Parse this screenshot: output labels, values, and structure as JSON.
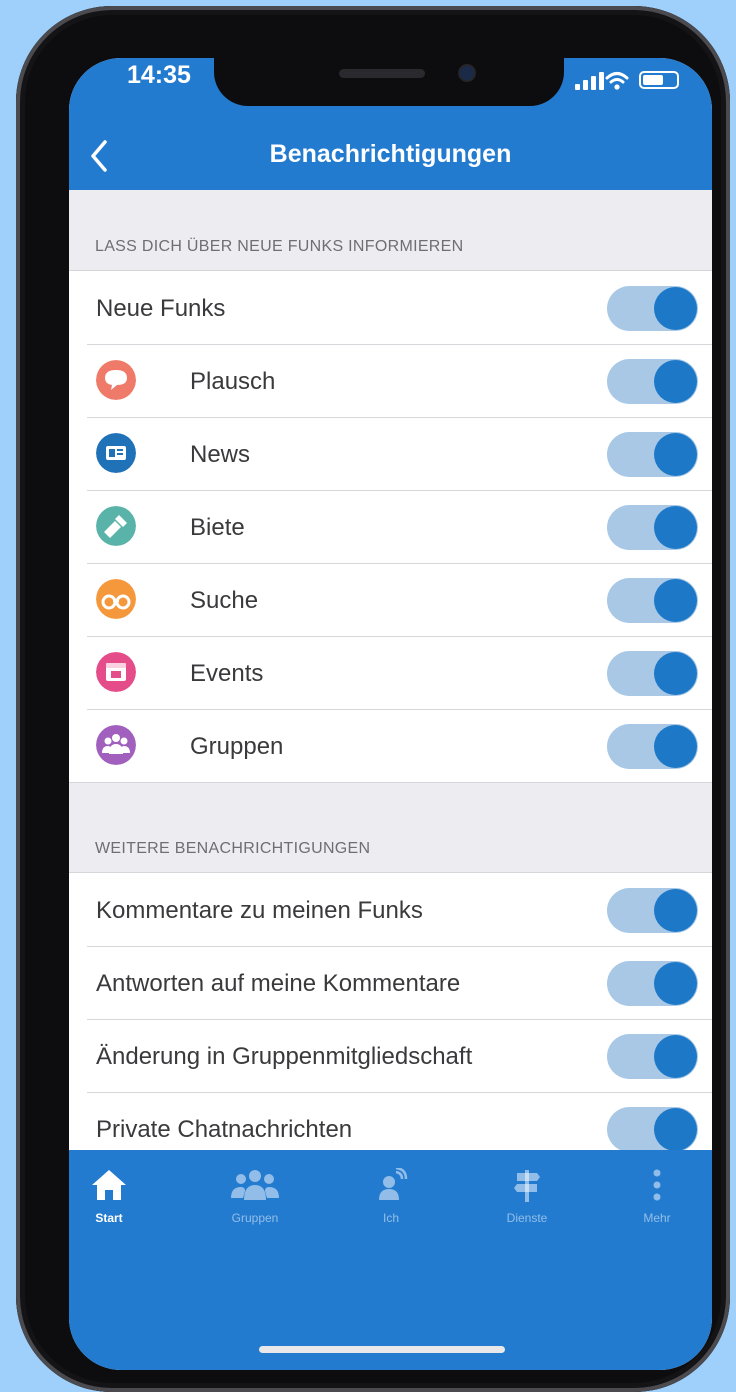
{
  "status_bar": {
    "time": "14:35"
  },
  "nav": {
    "title": "Benachrichtigungen"
  },
  "sections": [
    {
      "header": "LASS DICH ÜBER NEUE FUNKS INFORMIEREN",
      "rows": [
        {
          "label": "Neue Funks",
          "icon": null,
          "on": true
        },
        {
          "label": "Plausch",
          "icon": "speech-bubble-icon",
          "color": "#ef7a6a",
          "on": true
        },
        {
          "label": "News",
          "icon": "newspaper-icon",
          "color": "#1f71b8",
          "on": true
        },
        {
          "label": "Biete",
          "icon": "flashlight-icon",
          "color": "#5ab3a8",
          "on": true
        },
        {
          "label": "Suche",
          "icon": "binoculars-icon",
          "color": "#f5973b",
          "on": true
        },
        {
          "label": "Events",
          "icon": "calendar-icon",
          "color": "#e44d8a",
          "on": true
        },
        {
          "label": "Gruppen",
          "icon": "group-icon",
          "color": "#a15fbe",
          "on": true
        }
      ]
    },
    {
      "header": "WEITERE BENACHRICHTIGUNGEN",
      "rows": [
        {
          "label": "Kommentare zu meinen Funks",
          "on": true
        },
        {
          "label": "Antworten auf meine Kommentare",
          "on": true
        },
        {
          "label": "Änderung in Gruppenmitgliedschaft",
          "on": true
        },
        {
          "label": "Private Chatnachrichten",
          "on": true
        }
      ]
    }
  ],
  "tabbar": {
    "tabs": [
      {
        "label": "Start",
        "icon": "home-icon",
        "active": true
      },
      {
        "label": "Gruppen",
        "icon": "group-icon",
        "active": false
      },
      {
        "label": "Ich",
        "icon": "person-icon",
        "active": false
      },
      {
        "label": "Dienste",
        "icon": "signpost-icon",
        "active": false
      },
      {
        "label": "Mehr",
        "icon": "more-icon",
        "active": false
      }
    ]
  },
  "colors": {
    "brand": "#237bd0",
    "toggle_on": "#1d79c7",
    "toggle_track": "#a9c8e6",
    "background": "#ededf1"
  }
}
